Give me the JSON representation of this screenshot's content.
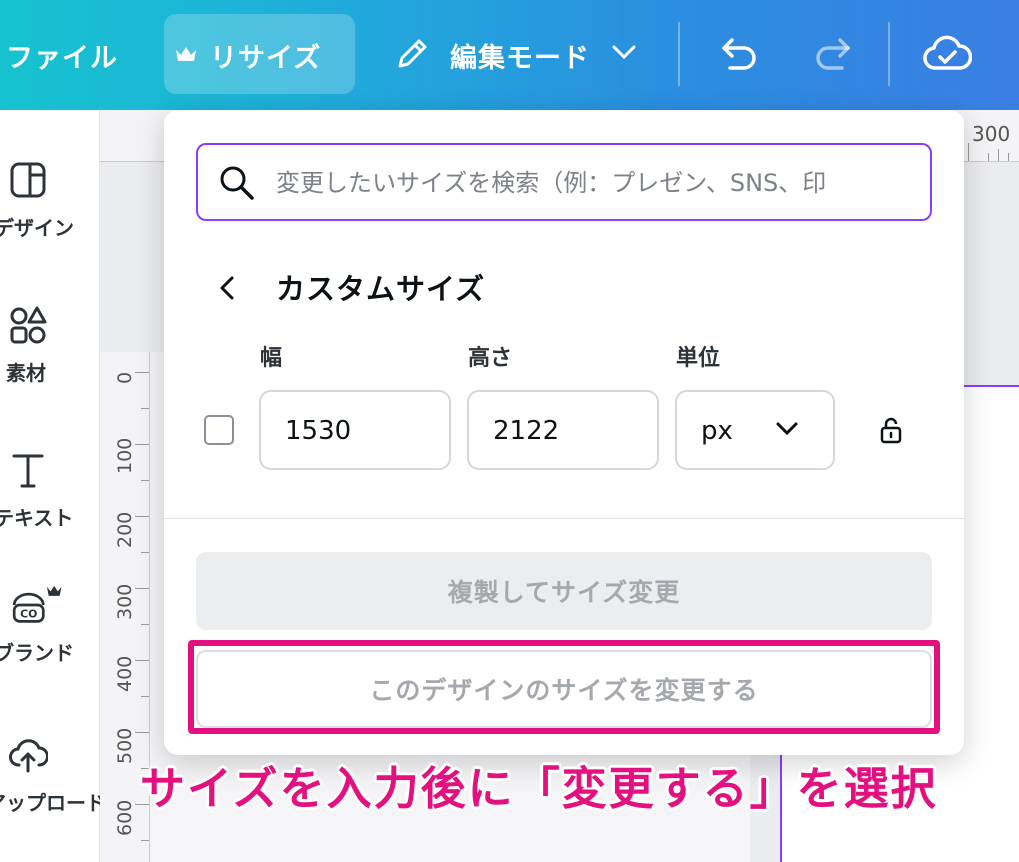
{
  "topbar": {
    "file_label": "ファイル",
    "resize_label": "リサイズ",
    "edit_mode_label": "編集モード",
    "accent": "#8b3dff"
  },
  "sidebar": {
    "items": [
      {
        "label": "デザイン",
        "icon": "layout-icon"
      },
      {
        "label": "素材",
        "icon": "shapes-icon"
      },
      {
        "label": "テキスト",
        "icon": "text-icon"
      },
      {
        "label": "ブランド",
        "icon": "brand-icon"
      },
      {
        "label": "アップロード",
        "icon": "cloud-upload-icon"
      }
    ]
  },
  "rulers": {
    "horizontal": [
      "300"
    ],
    "vertical": [
      "0",
      "100",
      "200",
      "300",
      "400",
      "500",
      "600"
    ]
  },
  "resize_panel": {
    "search_placeholder": "変更したいサイズを検索（例：プレゼン、SNS、印",
    "section_title": "カスタムサイズ",
    "width_label": "幅",
    "height_label": "高さ",
    "unit_label": "単位",
    "width_value": "1530",
    "height_value": "2122",
    "unit_value": "px",
    "copy_resize_button": "複製してサイズ変更",
    "resize_button": "このデザインのサイズを変更する"
  },
  "annotation": {
    "caption": "サイズを入力後に「変更する」を選択",
    "color": "#e4107f"
  }
}
